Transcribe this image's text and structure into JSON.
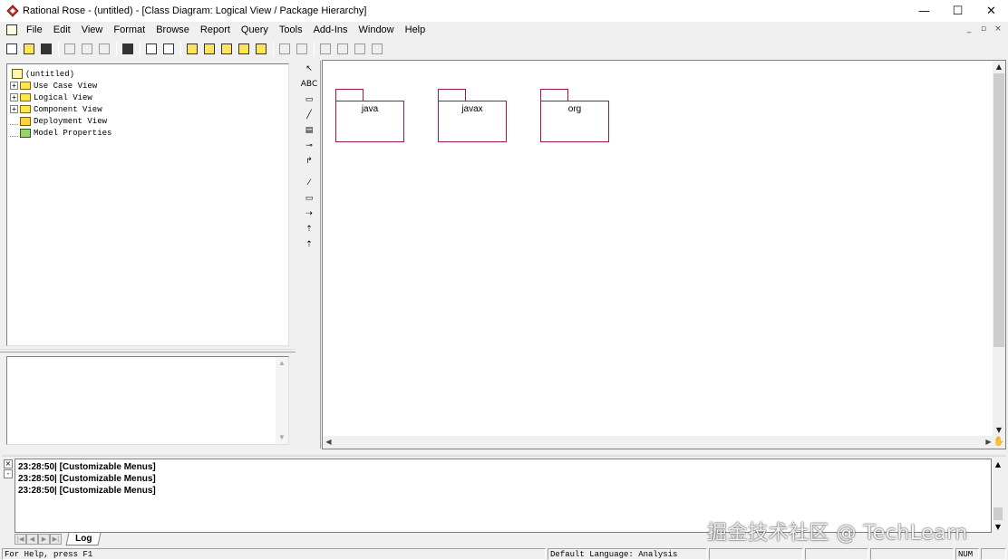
{
  "window": {
    "title": "Rational Rose - (untitled) - [Class Diagram: Logical View / Package Hierarchy]",
    "controls": [
      "—",
      "☐",
      "✕"
    ]
  },
  "menu": {
    "items": [
      "File",
      "Edit",
      "View",
      "Format",
      "Browse",
      "Report",
      "Query",
      "Tools",
      "Add-Ins",
      "Window",
      "Help"
    ],
    "mdi_controls": [
      "_",
      "▫",
      "×"
    ]
  },
  "toolbar": {
    "buttons": [
      {
        "icon": "new-icon"
      },
      {
        "icon": "open-icon"
      },
      {
        "icon": "save-icon"
      },
      {
        "sep": true
      },
      {
        "icon": "cut-icon"
      },
      {
        "icon": "copy-icon"
      },
      {
        "icon": "paste-icon"
      },
      {
        "sep": true
      },
      {
        "icon": "print-icon"
      },
      {
        "sep": true
      },
      {
        "icon": "context-help-icon"
      },
      {
        "icon": "view-doc-icon"
      },
      {
        "sep": true
      },
      {
        "icon": "browse-class-diagram-icon"
      },
      {
        "icon": "browse-interaction-diagram-icon"
      },
      {
        "icon": "browse-component-diagram-icon"
      },
      {
        "icon": "browse-deployment-diagram-icon"
      },
      {
        "icon": "browse-parent-icon"
      },
      {
        "sep": true
      },
      {
        "icon": "go-previous-diagram-icon"
      },
      {
        "icon": "back-icon"
      },
      {
        "sep": true
      },
      {
        "icon": "zoom-in-icon"
      },
      {
        "icon": "zoom-out-icon"
      },
      {
        "icon": "fit-in-window-icon"
      },
      {
        "icon": "undo-fit-icon"
      }
    ]
  },
  "browser": {
    "root": "(untitled)",
    "items": [
      {
        "label": "Use Case View",
        "type": "folder",
        "expandable": true
      },
      {
        "label": "Logical View",
        "type": "folder",
        "expandable": true
      },
      {
        "label": "Component View",
        "type": "folder",
        "expandable": true
      },
      {
        "label": "Deployment View",
        "type": "deployment",
        "expandable": false
      },
      {
        "label": "Model Properties",
        "type": "properties",
        "expandable": false
      }
    ]
  },
  "diagram_toolbox": {
    "tools": [
      "selection-arrow-icon",
      "ABC",
      "note-icon",
      "anchor-note-icon",
      "class-icon",
      "interface-icon",
      "association-icon",
      "sep",
      "unidirectional-association-icon",
      "package-icon",
      "dependency-icon",
      "generalization-icon",
      "realize-icon"
    ]
  },
  "diagram": {
    "packages": [
      "java",
      "javax",
      "org"
    ]
  },
  "log": {
    "lines": [
      "23:28:50|  [Customizable Menus]",
      "23:28:50|  [Customizable Menus]",
      "23:28:50|  [Customizable Menus]"
    ],
    "tab_label": "Log"
  },
  "watermark": "掘金技术社区 @ TechLearn",
  "status": {
    "help": "For Help, press F1",
    "language": "Default Language: Analysis",
    "num": "NUM"
  }
}
